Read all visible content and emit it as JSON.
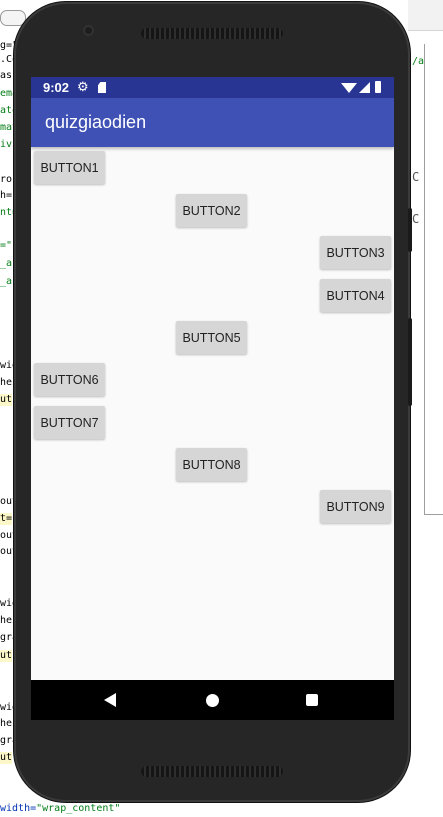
{
  "ide": {
    "left_lines": [
      {
        "text": "g=\"",
        "cls": ""
      },
      {
        "text": ".Co",
        "cls": ""
      },
      {
        "text": "as",
        "cls": ""
      },
      {
        "text": "ema",
        "cls": "g"
      },
      {
        "text": "ato",
        "cls": "g"
      },
      {
        "text": "mat",
        "cls": "g"
      },
      {
        "text": "ivi",
        "cls": "g"
      },
      {
        "text": "ro:",
        "cls": ""
      },
      {
        "text": "h=",
        "cls": ""
      },
      {
        "text": "nt=",
        "cls": "g"
      },
      {
        "text": "=\"",
        "cls": "g"
      },
      {
        "text": "_a",
        "cls": "g"
      },
      {
        "text": "_a",
        "cls": "g"
      },
      {
        "text": "wid",
        "cls": ""
      },
      {
        "text": "hei",
        "cls": ""
      },
      {
        "text": "ut",
        "cls": "hl"
      },
      {
        "text": "out",
        "cls": ""
      },
      {
        "text": "t=",
        "cls": "hl"
      },
      {
        "text": "out",
        "cls": ""
      },
      {
        "text": "out",
        "cls": ""
      },
      {
        "text": "wid",
        "cls": ""
      },
      {
        "text": "hei",
        "cls": ""
      },
      {
        "text": "gra",
        "cls": ""
      },
      {
        "text": "ut",
        "cls": "hl"
      },
      {
        "text": "wid",
        "cls": ""
      },
      {
        "text": "hei",
        "cls": ""
      },
      {
        "text": "gra",
        "cls": ""
      },
      {
        "text": "ut",
        "cls": "hl"
      }
    ],
    "right_frags": [
      {
        "text": "/a"
      },
      {
        "text": "C"
      },
      {
        "text": "C"
      }
    ],
    "bottom_attr": "width=",
    "bottom_val": "\"wrap_content\""
  },
  "status": {
    "time": "9:02",
    "gear_icon": "⚙"
  },
  "app": {
    "title": "quizgiaodien"
  },
  "buttons": [
    {
      "label": "BUTTON1"
    },
    {
      "label": "BUTTON2"
    },
    {
      "label": "BUTTON3"
    },
    {
      "label": "BUTTON4"
    },
    {
      "label": "BUTTON5"
    },
    {
      "label": "BUTTON6"
    },
    {
      "label": "BUTTON7"
    },
    {
      "label": "BUTTON8"
    },
    {
      "label": "BUTTON9"
    }
  ],
  "colors": {
    "status_bar": "#283593",
    "app_bar": "#3f51b5",
    "screen_bg": "#fafafa",
    "button_bg": "#d6d6d6",
    "nav_bar": "#000000"
  }
}
